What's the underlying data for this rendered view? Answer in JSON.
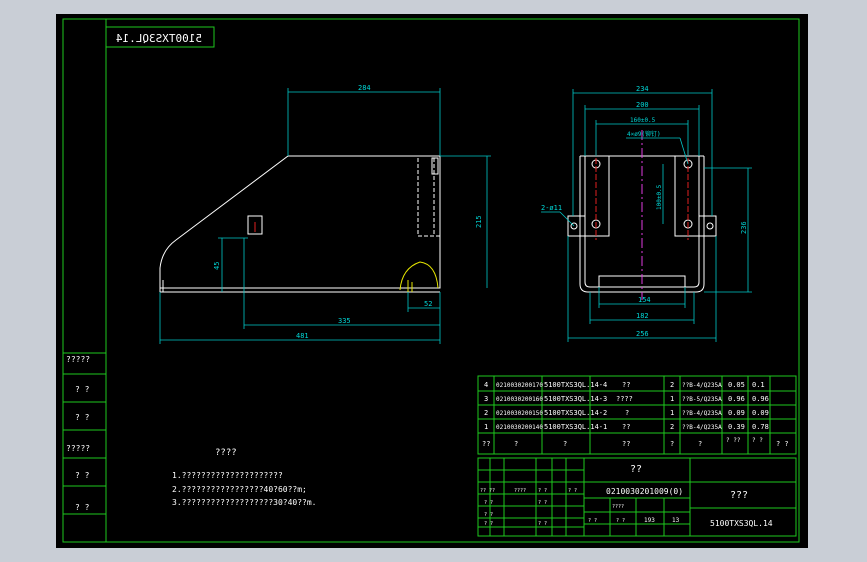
{
  "drawing_code_mirrored": "5100TXS3QL.14",
  "front_view": {
    "dims": [
      "284",
      "215",
      "45",
      "52",
      "335",
      "481"
    ]
  },
  "side_view": {
    "dims": [
      "234",
      "200",
      "160±0.5",
      "100±0.5",
      "236",
      "154",
      "182",
      "256"
    ],
    "callouts": [
      "2-ø11",
      "4×ø9(铆钉)"
    ]
  },
  "left_labels": [
    "?????",
    "? ?",
    "? ?",
    "?????",
    "? ?",
    "? ?"
  ],
  "notes": {
    "heading": "????",
    "lines": [
      "1.?????????????????????",
      "2.?????????????????40?60??m;",
      "3.???????????????????30?40??m."
    ]
  },
  "bom": {
    "rows": [
      [
        "4",
        "0210030200170",
        "5100TXS3QL.14-4",
        "??",
        "2",
        "??B-4/Q235A",
        "0.05",
        "0.1"
      ],
      [
        "3",
        "0210030200160",
        "5100TXS3QL.14-3",
        "????",
        "1",
        "??B-5/Q235A",
        "0.96",
        "0.96"
      ],
      [
        "2",
        "0210030200150",
        "5100TXS3QL.14-2",
        "?",
        "1",
        "??B-4/Q235A",
        "0.09",
        "0.09"
      ],
      [
        "1",
        "0210030200140",
        "5100TXS3QL.14-1",
        "??",
        "2",
        "??B-4/Q235A",
        "0.39",
        "0.78"
      ]
    ],
    "header": [
      "??",
      "?",
      "?",
      "??",
      "?",
      "?",
      "? ??",
      "? ?",
      "? ?"
    ]
  },
  "title_block": {
    "title": "??",
    "code": "0210030201009(0)",
    "company": "???",
    "drawing_no": "5100TXS3QL.14",
    "small_labels": [
      "?? ??",
      "????",
      "? ?",
      "? ?",
      "? ?",
      "? ?",
      "? ?",
      "? ?",
      "? ?",
      "????",
      "? ?",
      "? ?",
      "193",
      "13"
    ]
  },
  "colors": {
    "background": "#000000",
    "frame": "#1ec81e",
    "geometry": "#ffffff",
    "dimension": "#00c8c8",
    "weld": "#e6e600",
    "centerline": "#e02020"
  }
}
